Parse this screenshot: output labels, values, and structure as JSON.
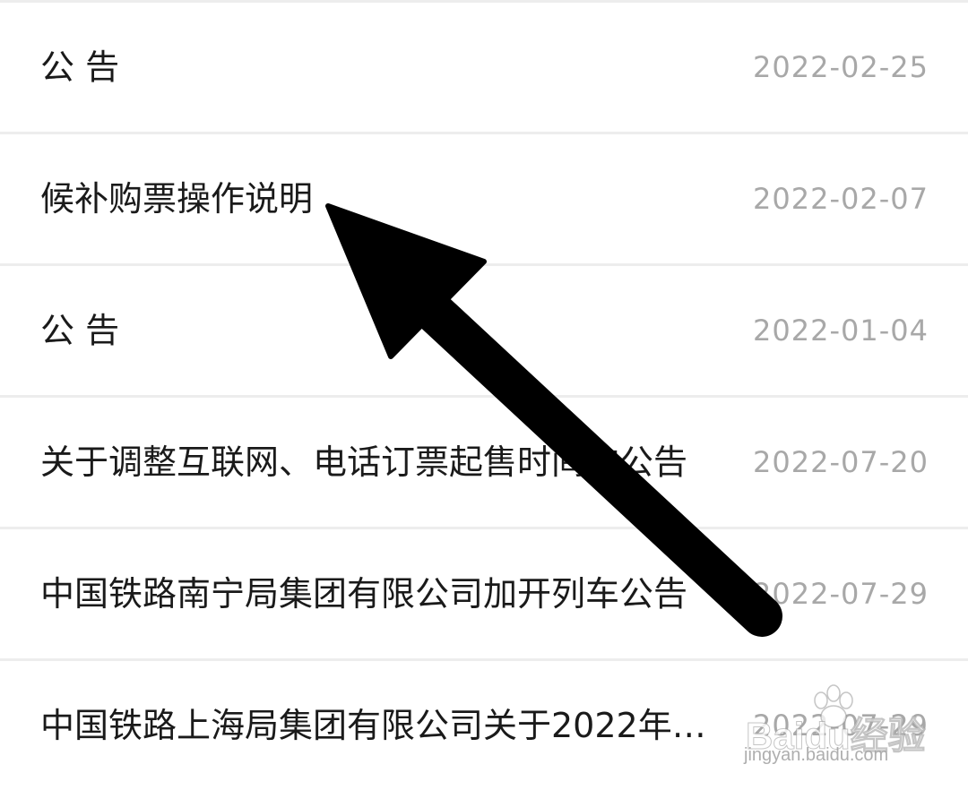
{
  "notices": [
    {
      "title": "公 告",
      "date": "2022-02-25"
    },
    {
      "title": "候补购票操作说明",
      "date": "2022-02-07"
    },
    {
      "title": "公 告",
      "date": "2022-01-04"
    },
    {
      "title": "关于调整互联网、电话订票起售时间的公告",
      "date": "2022-07-20"
    },
    {
      "title": "中国铁路南宁局集团有限公司加开列车公告",
      "date": "2022-07-29"
    },
    {
      "title": "中国铁路上海局集团有限公司关于2022年…",
      "date": "2022-07-29"
    }
  ],
  "overlay": {
    "arrow_color": "#000000"
  },
  "watermark": {
    "brand": "Baidu经验",
    "url": "jingyan.baidu.com"
  }
}
